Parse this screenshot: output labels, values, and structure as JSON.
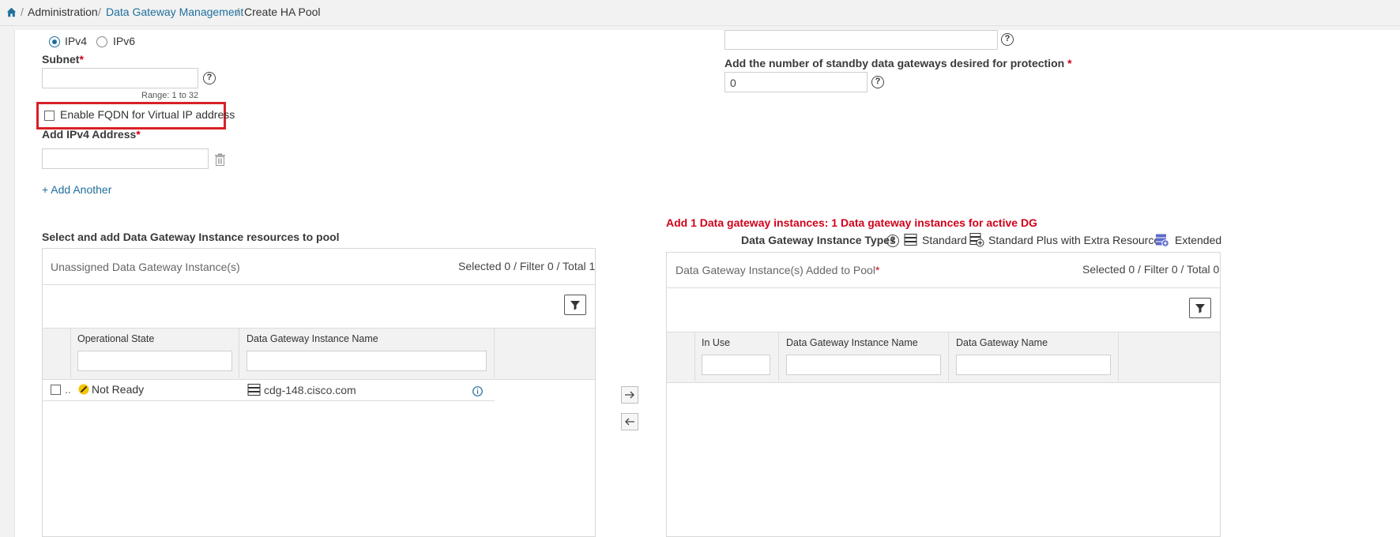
{
  "breadcrumb": {
    "home_icon": "home-icon",
    "items": [
      "Administration",
      "Data Gateway Management",
      "Create HA Pool"
    ],
    "separator": "/"
  },
  "left": {
    "ip_options": [
      "IPv4",
      "IPv6"
    ],
    "selected_ip": "IPv4",
    "subnet_label": "Subnet",
    "subnet_value": "",
    "subnet_hint": "Range: 1 to 32",
    "fqdn_label": "Enable FQDN for Virtual IP address",
    "fqdn_checked": false,
    "add_ipv4_label": "Add IPv4 Address",
    "add_another": "+ Add Another"
  },
  "right": {
    "top_field_value": "",
    "standby_label": "Add the number of standby data gateways desired for protection",
    "standby_value": "0"
  },
  "required_mark": "*",
  "unassigned": {
    "section_title": "Select and add Data Gateway Instance resources to pool",
    "panel_title": "Unassigned Data Gateway Instance(s)",
    "counts": "Selected 0 / Filter 0 / Total 1",
    "columns": [
      "Operational State",
      "Data Gateway Instance Name"
    ],
    "rows": [
      {
        "state": "Not Ready",
        "name": "cdg-148.cisco.com",
        "truncated": ".."
      }
    ]
  },
  "pool": {
    "warning": "Add 1 Data gateway instances: 1 Data gateway instances for active DG",
    "types_label": "Data Gateway Instance Types",
    "types": [
      "Standard",
      "Standard Plus with Extra Resources",
      "Extended"
    ],
    "panel_title": "Data Gateway Instance(s) Added to Pool",
    "counts": "Selected 0 / Filter 0 / Total 0",
    "columns": [
      "In Use",
      "Data Gateway Instance Name",
      "Data Gateway Name"
    ]
  },
  "colors": {
    "link": "#1f6f9c",
    "required": "#d0021b",
    "highlight": "#d92027",
    "warning_state": "#f5c400"
  }
}
